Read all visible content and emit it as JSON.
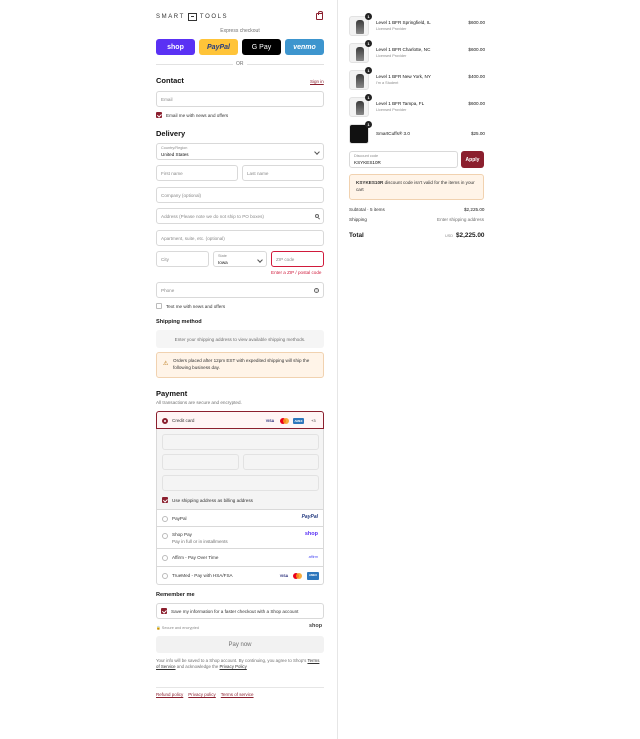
{
  "brand": {
    "name": "SMART",
    "name2": "TOOLS"
  },
  "express": {
    "label": "Express checkout",
    "shop": "shop",
    "paypal": "PayPal",
    "gpay": "G Pay",
    "venmo": "venmo",
    "or": "OR"
  },
  "contact": {
    "title": "Contact",
    "sign_in": "Sign in",
    "email_placeholder": "Email",
    "news_label": "Email me with news and offers"
  },
  "delivery": {
    "title": "Delivery",
    "country_label": "Country/Region",
    "country_value": "United States",
    "first_name": "First name",
    "last_name": "Last name",
    "company": "Company (optional)",
    "address": "Address (Please note we do not ship to PO boxes)",
    "apartment": "Apartment, suite, etc. (optional)",
    "city": "City",
    "state_label": "State",
    "state_value": "Iowa",
    "zip": "ZIP code",
    "zip_error": "Enter a ZIP / postal code",
    "phone": "Phone",
    "text_label": "Text me with news and offers"
  },
  "shipping": {
    "title": "Shipping method",
    "placeholder": "Enter your shipping address to view available shipping methods.",
    "warning": "Orders placed after 12pm EST with expedited shipping will ship the following business day."
  },
  "payment": {
    "title": "Payment",
    "subtitle": "All transactions are secure and encrypted.",
    "credit_card": "Credit card",
    "more_cards": "+3",
    "billing_same": "Use shipping address as billing address",
    "paypal": "PayPal",
    "paypal_logo": "PayPal",
    "shop_pay": "Shop Pay",
    "shop_pay_sub": "Pay in full or in installments",
    "shop_logo": "shop",
    "affirm": "Affirm - Pay Over Time",
    "affirm_logo": "affirm",
    "truemed": "TrueMed - Pay with HSA/FSA"
  },
  "remember": {
    "title": "Remember me",
    "save_label": "Save my information for a faster checkout with a Shop account",
    "secure": "Secure and encrypted",
    "shop_logo": "shop"
  },
  "pay_now": "Pay now",
  "footer_note_1": "Your info will be saved to a Shop account. By continuing, you agree to Shop's",
  "footer_terms": "Terms of Service",
  "footer_note_2": "and acknowledge the",
  "footer_privacy": "Privacy Policy",
  "footer_links": [
    "Refund policy",
    "Privacy policy",
    "Terms of service"
  ],
  "cart": {
    "items": [
      {
        "qty": "1",
        "name": "Level 1 BFR Springfield, IL",
        "sub": "Licensed Provider",
        "price": "$600.00"
      },
      {
        "qty": "1",
        "name": "Level 1 BFR Charlotte, NC",
        "sub": "Licensed Provider",
        "price": "$600.00"
      },
      {
        "qty": "1",
        "name": "Level 1 BFR New York, NY",
        "sub": "I'm a Student",
        "price": "$400.00"
      },
      {
        "qty": "1",
        "name": "Level 1 BFR Tampa, FL",
        "sub": "Licensed Provider",
        "price": "$600.00"
      },
      {
        "qty": "1",
        "name": "SmartCuffs® 3.0",
        "sub": "",
        "price": "$25.00"
      }
    ],
    "discount_label": "Discount code",
    "discount_value": "KSYKES10R",
    "apply": "Apply",
    "discount_code_bold": "KSYKES10R",
    "discount_warning": "discount code isn't valid for the items in your cart",
    "subtotal_label": "Subtotal · 5 items",
    "subtotal_value": "$2,225.00",
    "shipping_label": "Shipping",
    "shipping_value": "Enter shipping address",
    "total_label": "Total",
    "currency": "USD",
    "total_value": "$2,225.00"
  }
}
